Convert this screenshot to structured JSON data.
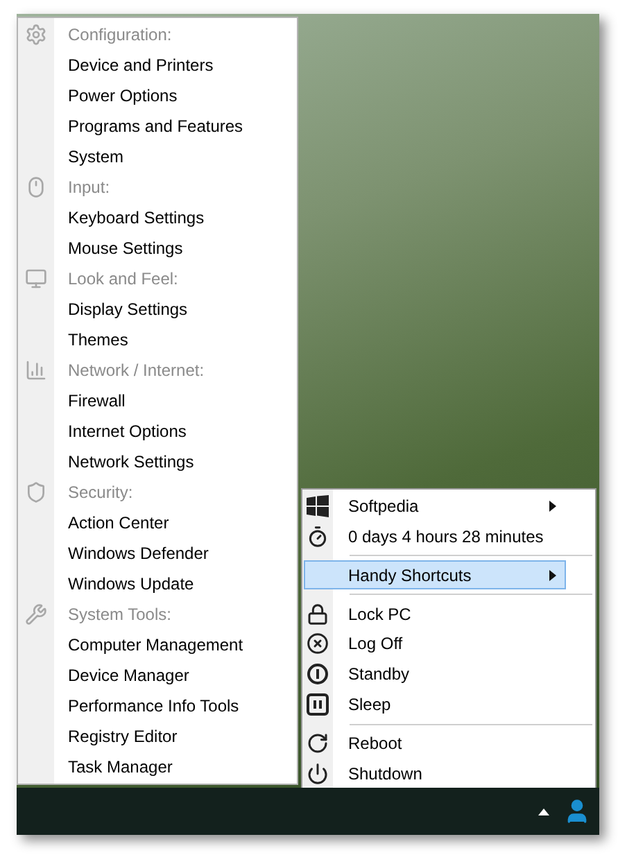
{
  "shortcuts_menu": {
    "sections": [
      {
        "title": "Configuration:",
        "items": [
          "Device and Printers",
          "Power Options",
          "Programs and Features",
          "System"
        ]
      },
      {
        "title": "Input:",
        "items": [
          "Keyboard Settings",
          "Mouse Settings"
        ]
      },
      {
        "title": "Look and Feel:",
        "items": [
          "Display Settings",
          "Themes"
        ]
      },
      {
        "title": "Network / Internet:",
        "items": [
          "Firewall",
          "Internet Options",
          "Network Settings"
        ]
      },
      {
        "title": "Security:",
        "items": [
          "Action Center",
          "Windows Defender",
          "Windows Update"
        ]
      },
      {
        "title": "System Tools:",
        "items": [
          "Computer Management",
          "Device Manager",
          "Performance Info Tools",
          "Registry Editor",
          "Task Manager"
        ]
      }
    ]
  },
  "tray_menu": {
    "items": [
      {
        "kind": "item",
        "label": "Softpedia",
        "submenu": true,
        "selected": false
      },
      {
        "kind": "item",
        "label": "0 days 4 hours 28 minutes",
        "submenu": false,
        "selected": false
      },
      {
        "kind": "separator"
      },
      {
        "kind": "item",
        "label": "Handy Shortcuts",
        "submenu": true,
        "selected": true
      },
      {
        "kind": "separator"
      },
      {
        "kind": "item",
        "label": "Lock PC",
        "submenu": false,
        "selected": false
      },
      {
        "kind": "item",
        "label": "Log Off",
        "submenu": false,
        "selected": false
      },
      {
        "kind": "item",
        "label": "Standby",
        "submenu": false,
        "selected": false
      },
      {
        "kind": "item",
        "label": "Sleep",
        "submenu": false,
        "selected": false
      },
      {
        "kind": "separator"
      },
      {
        "kind": "item",
        "label": "Reboot",
        "submenu": false,
        "selected": false
      },
      {
        "kind": "item",
        "label": "Shutdown",
        "submenu": false,
        "selected": false
      }
    ]
  }
}
